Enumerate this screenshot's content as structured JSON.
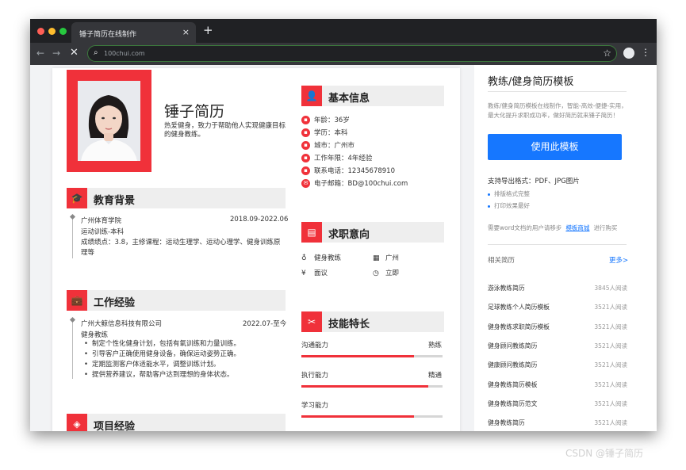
{
  "browser": {
    "tab_title": "锤子简历在线制作",
    "tab_close": "×",
    "new_tab": "+",
    "url": "100chui.com"
  },
  "resume": {
    "name": "锤子简历",
    "intro": "热爱健身，致力于帮助他人实现健康目标的健身教练。",
    "education": {
      "title": "教育背景",
      "school": "广州体育学院",
      "period": "2018.09-2022.06",
      "major": "运动训练-本科",
      "detail_line1": "成绩绩点：3.8，主修课程：运动生理学、运动心理学、健身训练原",
      "detail_line2": "理等"
    },
    "work": {
      "title": "工作经验",
      "company": "广州大鲸信息科技有限公司",
      "period": "2022.07-至今",
      "role": "健身教练",
      "duties": [
        "制定个性化健身计划，包括有氧训练和力量训练。",
        "引导客户正确使用健身设备，确保运动姿势正确。",
        "定期监测客户体适能水平，调整训练计划。",
        "提供营养建议，帮助客户达到理想的身体状态。"
      ]
    },
    "project": {
      "title": "项目经验"
    },
    "basic_info": {
      "title": "基本信息",
      "rows": [
        "年龄：36岁",
        "学历：本科",
        "城市：广州市",
        "工作年限：4年经验",
        "联系电话：12345678910",
        "电子邮箱：BD@100chui.com"
      ]
    },
    "job_intent": {
      "title": "求职意向",
      "position": "健身教练",
      "city": "广州",
      "salary": "面议",
      "availability": "立即"
    },
    "skills": {
      "title": "技能特长",
      "items": [
        {
          "label": "沟通能力",
          "level": "熟练",
          "value": 0.8
        },
        {
          "label": "执行能力",
          "level": "精通",
          "value": 0.9
        },
        {
          "label": "学习能力",
          "level": "",
          "value": 0.8
        }
      ]
    }
  },
  "sidebar": {
    "title": "教练/健身简历模板",
    "desc": "教练/健身简历模板在线制作，智能-高效-便捷-实用，最大化提升求职成功率，做好简历就来锤子简历！",
    "use_button": "使用此模板",
    "export_formats": "支持导出格式：PDF、JPG图片",
    "features": [
      "排版格式完整",
      "打印效果最好"
    ],
    "word_note": "需要word文档的用户请移步",
    "word_link": "模板商城",
    "word_tail": "进行购买",
    "related_title": "相关简历",
    "more": "更多>",
    "related": [
      {
        "name": "游泳教练简历",
        "views": "3845人阅读"
      },
      {
        "name": "足球教练个人简历模板",
        "views": "3521人阅读"
      },
      {
        "name": "健身教练求职简历模板",
        "views": "3521人阅读"
      },
      {
        "name": "健身顾问教练简历",
        "views": "3521人阅读"
      },
      {
        "name": "健康顾问教练简历",
        "views": "3521人阅读"
      },
      {
        "name": "健身教练简历模板",
        "views": "3521人阅读"
      },
      {
        "name": "健身教练简历范文",
        "views": "3521人阅读"
      },
      {
        "name": "健身教练简历",
        "views": "3521人阅读"
      }
    ]
  },
  "watermark": "CSDN @锤子简历",
  "colors": {
    "accent": "#f0313a",
    "link": "#1677ff"
  }
}
